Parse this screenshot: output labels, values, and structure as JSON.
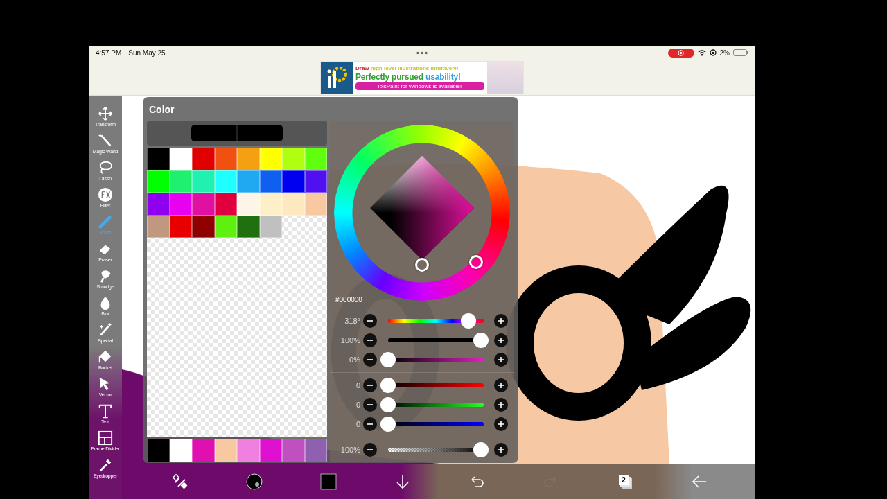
{
  "status_bar": {
    "time": "4:57 PM",
    "date": "Sun May 25",
    "battery": "2%"
  },
  "ad_banner": {
    "headline": [
      {
        "text": "Draw ",
        "color": "#d02020"
      },
      {
        "text": "high level illustrations intuitively!",
        "color": "#c8c020"
      }
    ],
    "tagline": [
      {
        "text": "Perfectly pursued ",
        "color": "#30a030"
      },
      {
        "text": "usability!",
        "color": "#30a0e0"
      }
    ],
    "button": "ibisPaint for Windows is available!"
  },
  "toolbar": {
    "tools": [
      {
        "label": "Transform",
        "selected": false
      },
      {
        "label": "Magic Wand",
        "selected": false
      },
      {
        "label": "Lasso",
        "selected": false
      },
      {
        "label": "Filter",
        "selected": false
      },
      {
        "label": "Brush",
        "selected": true
      },
      {
        "label": "Eraser",
        "selected": false
      },
      {
        "label": "Smudge",
        "selected": false
      },
      {
        "label": "Blur",
        "selected": false
      },
      {
        "label": "Special",
        "selected": false
      },
      {
        "label": "Bucket",
        "selected": false
      },
      {
        "label": "Vector",
        "selected": false
      },
      {
        "label": "Text",
        "selected": false
      },
      {
        "label": "Frame Divider",
        "selected": false
      },
      {
        "label": "Eyedropper",
        "selected": false
      }
    ]
  },
  "color_panel": {
    "title": "Color",
    "palette": [
      {
        "color": "#000000"
      },
      {
        "color": "#ffffff"
      },
      {
        "color": "#e00000"
      },
      {
        "color": "#f05010"
      },
      {
        "color": "#f5a010"
      },
      {
        "color": "#ffff00"
      },
      {
        "color": "#b0ff10"
      },
      {
        "color": "#60ff10"
      },
      {
        "color": "#00ff00"
      },
      {
        "color": "#20f070"
      },
      {
        "color": "#20f0b0"
      },
      {
        "color": "#20ffff"
      },
      {
        "color": "#20a8f0"
      },
      {
        "color": "#1060f0"
      },
      {
        "color": "#0000f0"
      },
      {
        "color": "#5010f0"
      },
      {
        "color": "#9000f0"
      },
      {
        "color": "#e800f0"
      },
      {
        "color": "#e010a0"
      },
      {
        "color": "#e00040"
      },
      {
        "color": "#fdf5e8"
      },
      {
        "color": "#fdf0c8"
      },
      {
        "color": "#fde8c0"
      },
      {
        "color": "#f8c8a0"
      },
      {
        "color": "#c09880"
      },
      {
        "color": "#e80000"
      },
      {
        "color": "#900000"
      },
      {
        "color": "#60f010"
      },
      {
        "color": "#207010"
      },
      {
        "color": "#c0c0c0"
      }
    ],
    "recent_colors": [
      {
        "color": "#000000"
      },
      {
        "color": "#ffffff"
      },
      {
        "color": "#e010b0"
      },
      {
        "color": "#f8c8a0"
      },
      {
        "color": "#f080e0"
      },
      {
        "color": "#e010d0"
      },
      {
        "color": "#c050c0"
      },
      {
        "color": "#9060b0"
      }
    ],
    "hex": "#000000",
    "slider_groups": [
      [
        {
          "kind": "hue",
          "reading": "318°",
          "level": 0.84
        },
        {
          "kind": "saturation",
          "reading": "100%",
          "level": 0.97
        },
        {
          "kind": "brightness",
          "reading": "0%",
          "level": 0
        }
      ],
      [
        {
          "kind": "red",
          "reading": "0",
          "level": 0
        },
        {
          "kind": "green",
          "reading": "0",
          "level": 0
        },
        {
          "kind": "blue",
          "reading": "0",
          "level": 0
        }
      ],
      [
        {
          "kind": "opacity",
          "reading": "100%",
          "level": 0.97
        }
      ]
    ]
  },
  "bottom_bar": {
    "items": [
      {
        "kind": "transform",
        "disabled": false
      },
      {
        "kind": "brush-size",
        "disabled": false
      },
      {
        "kind": "color",
        "disabled": false
      },
      {
        "kind": "download",
        "disabled": false
      },
      {
        "kind": "undo",
        "disabled": false
      },
      {
        "kind": "redo",
        "disabled": true
      },
      {
        "kind": "layers",
        "disabled": false,
        "count": "2"
      },
      {
        "kind": "back",
        "disabled": false
      }
    ]
  }
}
